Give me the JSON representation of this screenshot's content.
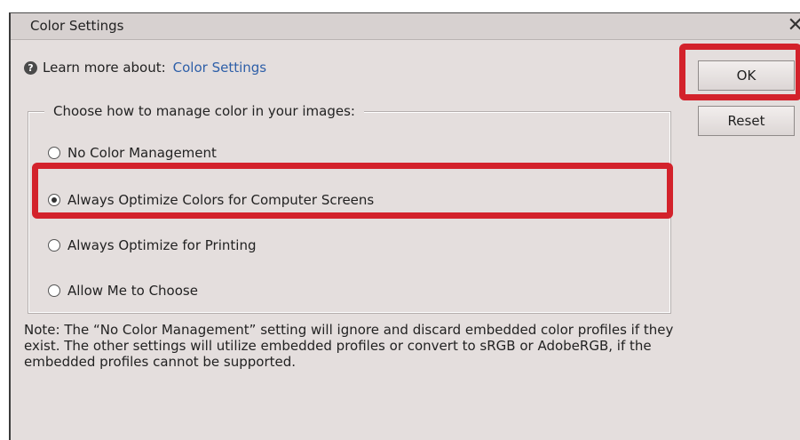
{
  "dialog": {
    "title": "Color Settings",
    "close_glyph": "✕",
    "help_icon": "?",
    "learn_prefix": "Learn more about:",
    "learn_link": "Color Settings",
    "group_label": "Choose how to manage color in your images:",
    "options": [
      {
        "label": "No Color Management",
        "selected": false
      },
      {
        "label": "Always Optimize Colors for Computer Screens",
        "selected": true
      },
      {
        "label": "Always Optimize for Printing",
        "selected": false
      },
      {
        "label": "Allow Me to Choose",
        "selected": false
      }
    ],
    "note": "Note: The “No Color Management” setting will ignore and discard embedded color profiles if they exist. The other settings will utilize embedded profiles or convert to sRGB or AdobeRGB, if the embedded profiles cannot be supported.",
    "ok_label": "OK",
    "reset_label": "Reset"
  },
  "colors": {
    "dialog_bg": "#e4dedd",
    "highlight": "#d3222b",
    "link": "#2e5fa8"
  }
}
